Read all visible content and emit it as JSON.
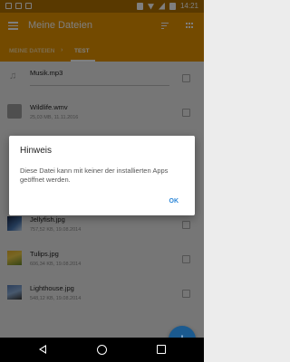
{
  "status_bar": {
    "time": "14:21"
  },
  "app_bar": {
    "title": "Meine Dateien"
  },
  "breadcrumb": {
    "root": "MEINE DATEIEN",
    "separator": "›",
    "current": "TEST"
  },
  "files": [
    {
      "name": "Musik.mp3",
      "meta": "",
      "icon": "music-icon"
    },
    {
      "name": "Wildlife.wmv",
      "meta": "25,03 MB, 11.11.2016",
      "icon": "video-icon"
    },
    {
      "name": "Jellyfish.jpg",
      "meta": "757,52 KB, 19.08.2014",
      "icon": "image-thumbnail"
    },
    {
      "name": "Tulips.jpg",
      "meta": "606,34 KB, 19.08.2014",
      "icon": "image-thumbnail"
    },
    {
      "name": "Lighthouse.jpg",
      "meta": "548,12 KB, 19.08.2014",
      "icon": "image-thumbnail"
    }
  ],
  "dialog": {
    "title": "Hinweis",
    "message": "Diese Datei kann mit keiner der installierten Apps geöffnet werden.",
    "ok_label": "OK"
  },
  "fab": {
    "label": "+"
  },
  "colors": {
    "accent": "#e69400",
    "status_bar": "#b37200",
    "fab": "#1b5a8f",
    "dialog_button": "#2b86d8"
  }
}
